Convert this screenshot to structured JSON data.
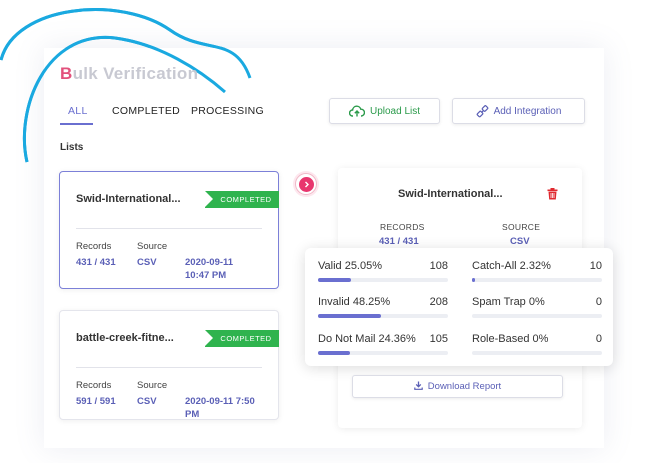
{
  "title": {
    "first_letter": "B",
    "rest": "ulk Verification"
  },
  "tabs": [
    {
      "label": "ALL",
      "active": true
    },
    {
      "label": "COMPLETED",
      "active": false
    },
    {
      "label": "PROCESSING",
      "active": false
    }
  ],
  "toolbar": {
    "upload_label": "Upload List",
    "integration_label": "Add Integration"
  },
  "lists_label": "Lists",
  "cards": [
    {
      "name": "Swid-International...",
      "status": "COMPLETED",
      "records_label": "Records",
      "records": "431 / 431",
      "source_label": "Source",
      "source": "CSV",
      "date": "2020-09-11",
      "time": "10:47 PM"
    },
    {
      "name": "battle-creek-fitne...",
      "status": "COMPLETED",
      "records_label": "Records",
      "records": "591 / 591",
      "source_label": "Source",
      "source": "CSV",
      "date": "2020-09-11 7:50",
      "time": "PM"
    }
  ],
  "detail": {
    "name": "Swid-International...",
    "records_label": "RECORDS",
    "records": "431 / 431",
    "source_label": "SOURCE",
    "source": "CSV",
    "download_label": "Download Report"
  },
  "stats": [
    {
      "label": "Valid  25.05%",
      "count": "108",
      "fraction": 0.2505
    },
    {
      "label": "Catch-All  2.32%",
      "count": "10",
      "fraction": 0.0232
    },
    {
      "label": "Invalid  48.25%",
      "count": "208",
      "fraction": 0.4825
    },
    {
      "label": "Spam Trap  0%",
      "count": "0",
      "fraction": 0
    },
    {
      "label": "Do Not Mail  24.36%",
      "count": "105",
      "fraction": 0.2436
    },
    {
      "label": "Role-Based  0%",
      "count": "0",
      "fraction": 0
    }
  ],
  "colors": {
    "accent": "#6a6fd0",
    "brand_pink": "#e2517c",
    "success": "#2fb34e",
    "danger": "#e8366e",
    "decor_line": "#1aa9e0"
  },
  "icons": {
    "upload": "cloud-upload-icon",
    "integration": "plug-icon",
    "trash": "trash-icon",
    "download": "download-icon",
    "arrow": "chevron-right-icon"
  }
}
